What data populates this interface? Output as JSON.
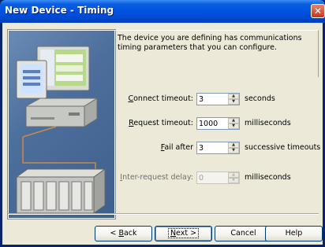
{
  "window": {
    "title": "New Device - Timing"
  },
  "description": "The device you are defining has communications timing parameters that you can configure.",
  "fields": [
    {
      "key": "C",
      "label_rest": "onnect timeout:",
      "value": "3",
      "unit": "seconds",
      "enabled": true
    },
    {
      "key": "R",
      "label_rest": "equest timeout:",
      "value": "1000",
      "unit": "milliseconds",
      "enabled": true
    },
    {
      "key": "F",
      "label_rest": "ail after",
      "value": "3",
      "unit": "successive timeouts",
      "enabled": true
    },
    {
      "key": "I",
      "label_rest": "nter-request delay:",
      "value": "0",
      "unit": "milliseconds",
      "enabled": false
    }
  ],
  "buttons": {
    "back": {
      "prefix": "< ",
      "key": "B",
      "rest": "ack"
    },
    "next": {
      "key": "N",
      "rest": "ext >"
    },
    "cancel": "Cancel",
    "help": "Help"
  },
  "icons": {
    "close": "close-icon",
    "spin_up": "spin-up-icon",
    "spin_down": "spin-down-icon"
  }
}
